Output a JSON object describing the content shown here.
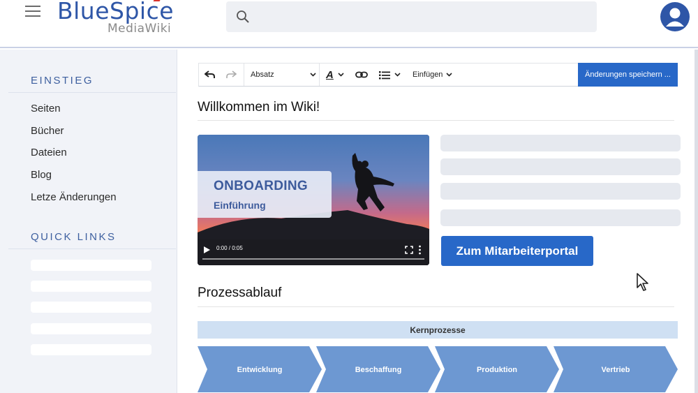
{
  "header": {
    "logo_main": "BlueSpice",
    "logo_sub": "MediaWiki",
    "menu_icon": "hamburger-icon",
    "search_icon": "search-icon",
    "avatar_icon": "user-avatar-icon"
  },
  "sidebar": {
    "heading_einstieg": "EINSTIEG",
    "items": [
      {
        "label": "Seiten"
      },
      {
        "label": "Bücher"
      },
      {
        "label": "Dateien"
      },
      {
        "label": "Blog"
      },
      {
        "label": "Letze Änderungen"
      }
    ],
    "heading_quicklinks": "QUICK LINKS"
  },
  "toolbar": {
    "undo_icon": "undo-icon",
    "redo_icon": "redo-icon",
    "format_label": "Absatz",
    "text_style_icon": "text-style-icon",
    "link_icon": "link-icon",
    "list_icon": "list-icon",
    "insert_label": "Einfügen",
    "save_label": "Änderungen speichern ..."
  },
  "page": {
    "title": "Willkommen im Wiki!",
    "video": {
      "title": "ONBOARDING",
      "subtitle": "Einführung",
      "time": "0:00 / 0:05",
      "progress": 0
    },
    "portal_button": "Zum Mitarbeiterportal",
    "section_title": "Prozessablauf",
    "core_label": "Kernprozesse",
    "process_steps": [
      "Entwicklung",
      "Beschaffung",
      "Produktion",
      "Vertrieb"
    ]
  },
  "colors": {
    "brand_blue": "#2e56a7",
    "button_blue": "#2868c8",
    "chevron_blue": "#6d98d2",
    "kern_bg": "#cfe0f3",
    "sidebar_bg": "#f1f3f8"
  }
}
